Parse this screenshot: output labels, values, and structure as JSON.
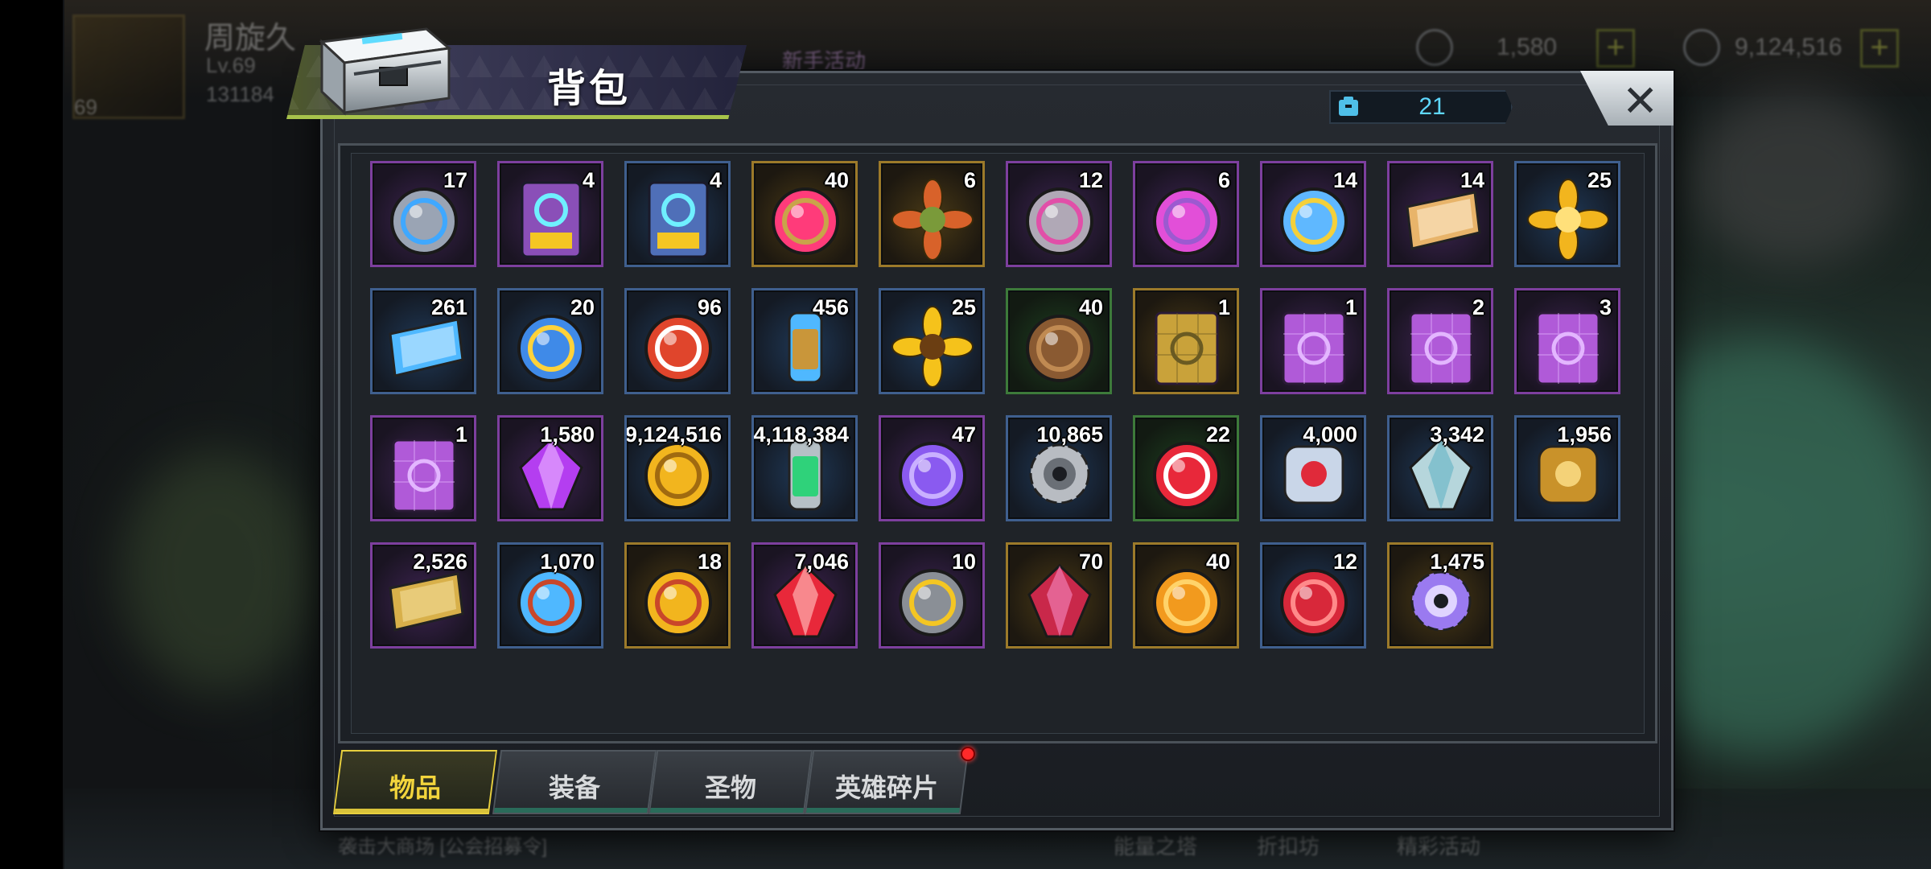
{
  "background": {
    "player_name": "周旋久",
    "player_level": "Lv.69",
    "player_power": "131184",
    "avatar_badge": "69",
    "event_button": "新手活动",
    "resource_1_value": "1,580",
    "resource_2_value": "9,124,516",
    "chat_hint": "袭击大商场 [公会招募令]",
    "bottom_menu": [
      "能量之塔",
      "折扣坊",
      "精彩活动"
    ]
  },
  "panel": {
    "title": "背包",
    "capacity_value": "21",
    "colors": {
      "accent_green": "#a7c24b",
      "active_tab": "#e7cf3e",
      "capacity_text": "#5fd8ff",
      "red_dot": "#ff2a2a"
    }
  },
  "items": [
    {
      "qty": "17",
      "icon": "time-warp-device-icon",
      "frame": "purple"
    },
    {
      "qty": "4",
      "icon": "12h-speedup-card-icon",
      "frame": "purple"
    },
    {
      "qty": "4",
      "icon": "4h-speedup-card-icon",
      "frame": "blue"
    },
    {
      "qty": "40",
      "icon": "pink-bottlecap-icon",
      "frame": "gold"
    },
    {
      "qty": "6",
      "icon": "flower-wreath-icon",
      "frame": "gold"
    },
    {
      "qty": "12",
      "icon": "film-reel-icon",
      "frame": "purple"
    },
    {
      "qty": "6",
      "icon": "purple-bottlecap-icon",
      "frame": "purple"
    },
    {
      "qty": "14",
      "icon": "police-badge-icon",
      "frame": "purple"
    },
    {
      "qty": "14",
      "icon": "pie-slice-icon",
      "frame": "purple"
    },
    {
      "qty": "25",
      "icon": "golden-leaf-icon",
      "frame": "blue"
    },
    {
      "qty": "261",
      "icon": "cinema-ticket-icon",
      "frame": "blue"
    },
    {
      "qty": "20",
      "icon": "blue-b-bottlecap-icon",
      "frame": "blue"
    },
    {
      "qty": "96",
      "icon": "casino-chip-icon",
      "frame": "blue"
    },
    {
      "qty": "456",
      "icon": "bullet-icon",
      "frame": "blue"
    },
    {
      "qty": "25",
      "icon": "sunflower-icon",
      "frame": "blue"
    },
    {
      "qty": "40",
      "icon": "pine-cone-icon",
      "frame": "green"
    },
    {
      "qty": "1",
      "icon": "gold-blueprint-icon",
      "frame": "gold"
    },
    {
      "qty": "1",
      "icon": "boot-blueprint-icon",
      "frame": "purple"
    },
    {
      "qty": "2",
      "icon": "glasses-blueprint-icon",
      "frame": "purple"
    },
    {
      "qty": "3",
      "icon": "revolver-blueprint-icon",
      "frame": "purple"
    },
    {
      "qty": "1",
      "icon": "hat-blueprint-icon",
      "frame": "purple"
    },
    {
      "qty": "1,580",
      "icon": "purple-crystal-icon",
      "frame": "purple"
    },
    {
      "qty": "9,124,516",
      "icon": "gold-coins-icon",
      "frame": "blue"
    },
    {
      "qty": "4,118,384",
      "icon": "green-battery-icon",
      "frame": "blue"
    },
    {
      "qty": "47",
      "icon": "purple-orb-icon",
      "frame": "purple"
    },
    {
      "qty": "10,865",
      "icon": "gear-icon",
      "frame": "blue"
    },
    {
      "qty": "22",
      "icon": "red-share-token-icon",
      "frame": "green"
    },
    {
      "qty": "4,000",
      "icon": "eye-emblem-icon",
      "frame": "blue"
    },
    {
      "qty": "3,342",
      "icon": "triangle-shard-icon",
      "frame": "blue"
    },
    {
      "qty": "1,956",
      "icon": "golden-fist-icon",
      "frame": "blue"
    },
    {
      "qty": "2,526",
      "icon": "puzzle-piece-icon",
      "frame": "purple"
    },
    {
      "qty": "1,070",
      "icon": "ship-medal-blue-icon",
      "frame": "blue"
    },
    {
      "qty": "18",
      "icon": "ship-medal-gold-icon",
      "frame": "gold"
    },
    {
      "qty": "7,046",
      "icon": "biohazard-gem-icon",
      "frame": "purple"
    },
    {
      "qty": "10",
      "icon": "lightning-coin-icon",
      "frame": "purple"
    },
    {
      "qty": "70",
      "icon": "red-crystal-icon",
      "frame": "gold"
    },
    {
      "qty": "40",
      "icon": "orange-coin-icon",
      "frame": "gold"
    },
    {
      "qty": "12",
      "icon": "red-target-icon",
      "frame": "blue"
    },
    {
      "qty": "1,475",
      "icon": "purple-gear-orb-icon",
      "frame": "gold"
    }
  ],
  "tabs": [
    {
      "label": "物品",
      "active": true
    },
    {
      "label": "装备",
      "active": false
    },
    {
      "label": "圣物",
      "active": false
    },
    {
      "label": "英雄碎片",
      "active": false
    }
  ]
}
